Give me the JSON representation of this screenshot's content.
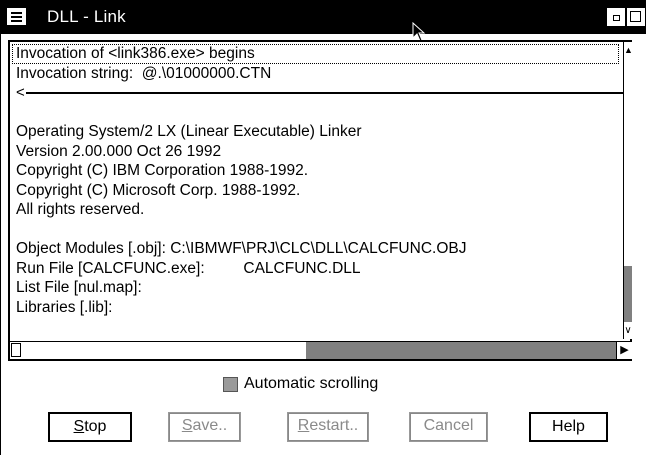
{
  "window": {
    "title": "DLL - Link"
  },
  "output": {
    "lines": [
      "Invocation of <link386.exe> begins",
      "Invocation string:  @.\\01000000.CTN",
      "",
      "",
      "Operating System/2 LX (Linear Executable) Linker",
      "Version 2.00.000 Oct 26 1992",
      "Copyright (C) IBM Corporation 1988-1992.",
      "Copyright (C) Microsoft Corp. 1988-1992.",
      "All rights reserved.",
      "",
      "Object Modules [.obj]: C:\\IBMWF\\PRJ\\CLC\\DLL\\CALCFUNC.OBJ",
      "Run File [CALCFUNC.exe]:         CALCFUNC.DLL",
      "List File [nul.map]:",
      "Libraries [.lib]:"
    ]
  },
  "options": {
    "automatic_scrolling_label": "Automatic scrolling",
    "automatic_scrolling_checked": false
  },
  "buttons": {
    "stop": {
      "mnemonic": "S",
      "rest": "top"
    },
    "save": {
      "mnemonic": "S",
      "rest": "ave.."
    },
    "restart": {
      "mnemonic": "R",
      "rest": "estart.."
    },
    "cancel": {
      "label": "Cancel"
    },
    "help": {
      "label": "Help"
    }
  },
  "icons": {
    "system_menu": "system-menu-icon",
    "minimize": "minimize-icon",
    "maximize": "maximize-icon",
    "pointer": "mouse-pointer-icon"
  }
}
